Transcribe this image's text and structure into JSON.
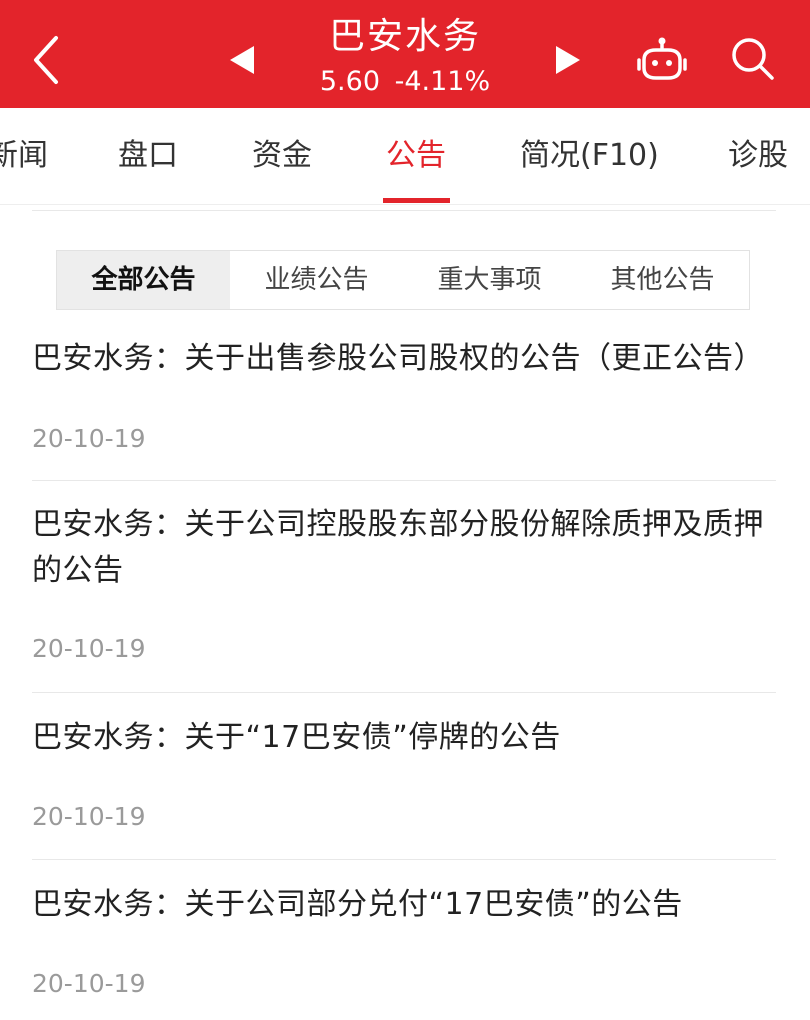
{
  "header": {
    "stock_name": "巴安水务",
    "price": "5.60",
    "change_pct": "-4.11%",
    "background_color": "#e3242b",
    "icons": [
      "back-arrow-icon",
      "prev-triangle-icon",
      "next-triangle-icon",
      "robot-icon",
      "search-icon"
    ]
  },
  "tabs": {
    "items": [
      "新闻",
      "盘口",
      "资金",
      "公告",
      "简况(F10)",
      "诊股"
    ],
    "active": "公告",
    "active_color": "#e3242b"
  },
  "filter": {
    "items": [
      "全部公告",
      "业绩公告",
      "重大事项",
      "其他公告"
    ],
    "active": "全部公告"
  },
  "announcements": [
    {
      "title": "巴安水务：关于出售参股公司股权的公告（更正公告）",
      "date": "20-10-19"
    },
    {
      "title": "巴安水务：关于公司控股股东部分股份解除质押及质押的公告",
      "date": "20-10-19"
    },
    {
      "title": "巴安水务：关于“17巴安债”停牌的公告",
      "date": "20-10-19"
    },
    {
      "title": "巴安水务：关于公司部分兑付“17巴安债”的公告",
      "date": "20-10-19"
    }
  ]
}
